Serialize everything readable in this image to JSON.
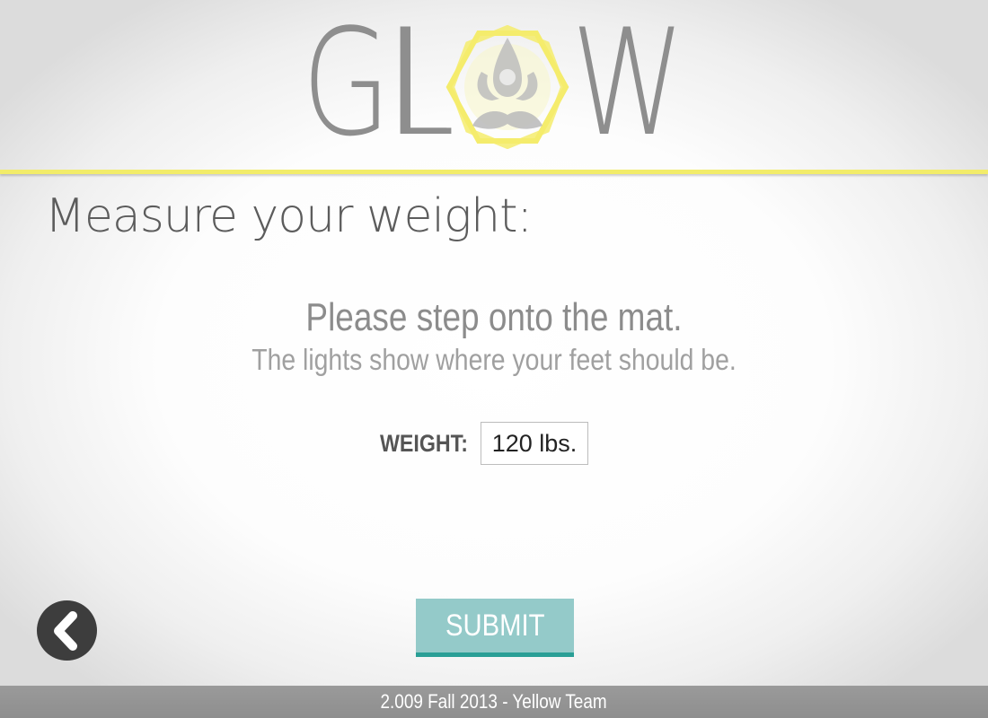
{
  "app": {
    "logo_text": "GLOW",
    "logo_left": "GL",
    "logo_right": "W",
    "logo_icon": "meditating-figure-hexagon-icon"
  },
  "page": {
    "title": "Measure your weight:"
  },
  "instructions": {
    "main": "Please step onto the mat.",
    "sub": "The lights show where your feet should be."
  },
  "weight": {
    "label": "WEIGHT:",
    "value": "120 lbs."
  },
  "actions": {
    "submit_label": "SUBMIT",
    "back_icon": "chevron-left-icon"
  },
  "footer": {
    "text": "2.009 Fall 2013 - Yellow Team"
  },
  "colors": {
    "accent_yellow": "#f2ec6a",
    "logo_gray": "#8e8e8e",
    "submit_fill": "#94cac9",
    "submit_border": "#2a9f96",
    "back_button": "#3d3d3d",
    "footer_bar": "#959595"
  }
}
